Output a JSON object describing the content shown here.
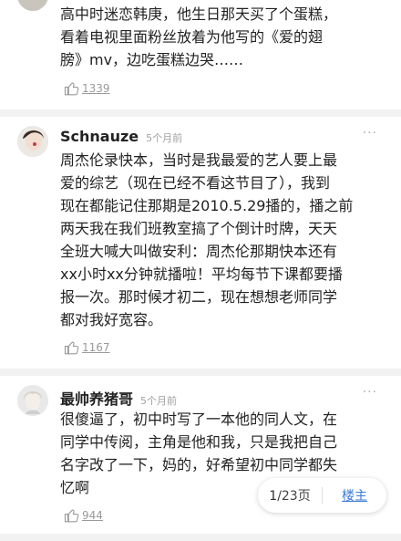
{
  "comments": [
    {
      "name": "",
      "time": "",
      "lines": [
        "高中时迷恋韩庚，他生日那天买了个蛋糕，",
        "看着电视里面粉丝放着为他写的《爱的翅",
        "膀》mv，边吃蛋糕边哭……"
      ],
      "likes": "1339"
    },
    {
      "name": "Schnauze",
      "time": "5个月前",
      "lines": [
        "周杰伦录快本，当时是我最爱的艺人要上最",
        "爱的综艺（现在已经不看这节目了），我到",
        "现在都能记住那期是2010.5.29播的，播之前",
        "两天我在我们班教室搞了个倒计时牌，天天",
        "全班大喊大叫做安利：周杰伦那期快本还有",
        "xx小时xx分钟就播啦！平均每节下课都要播",
        "报一次。那时候才初二，现在想想老师同学",
        "都对我好宽容。"
      ],
      "likes": "1167"
    },
    {
      "name": "最帅养猪哥",
      "time": "5个月前",
      "lines": [
        "很傻逼了，初中时写了一本他的同人文，在",
        "同学中传阅，主角是他和我，只是我把自己",
        "名字改了一下，妈的，好希望初中同学都失",
        "忆啊"
      ],
      "likes": "944"
    }
  ],
  "more_icon": "···",
  "pager": {
    "current": "1",
    "total_label": "/23页",
    "op_label": "楼主"
  },
  "colors": {
    "divider": "#f2f2f2",
    "link": "#3a7bd5",
    "meta": "#a0a0a0"
  }
}
